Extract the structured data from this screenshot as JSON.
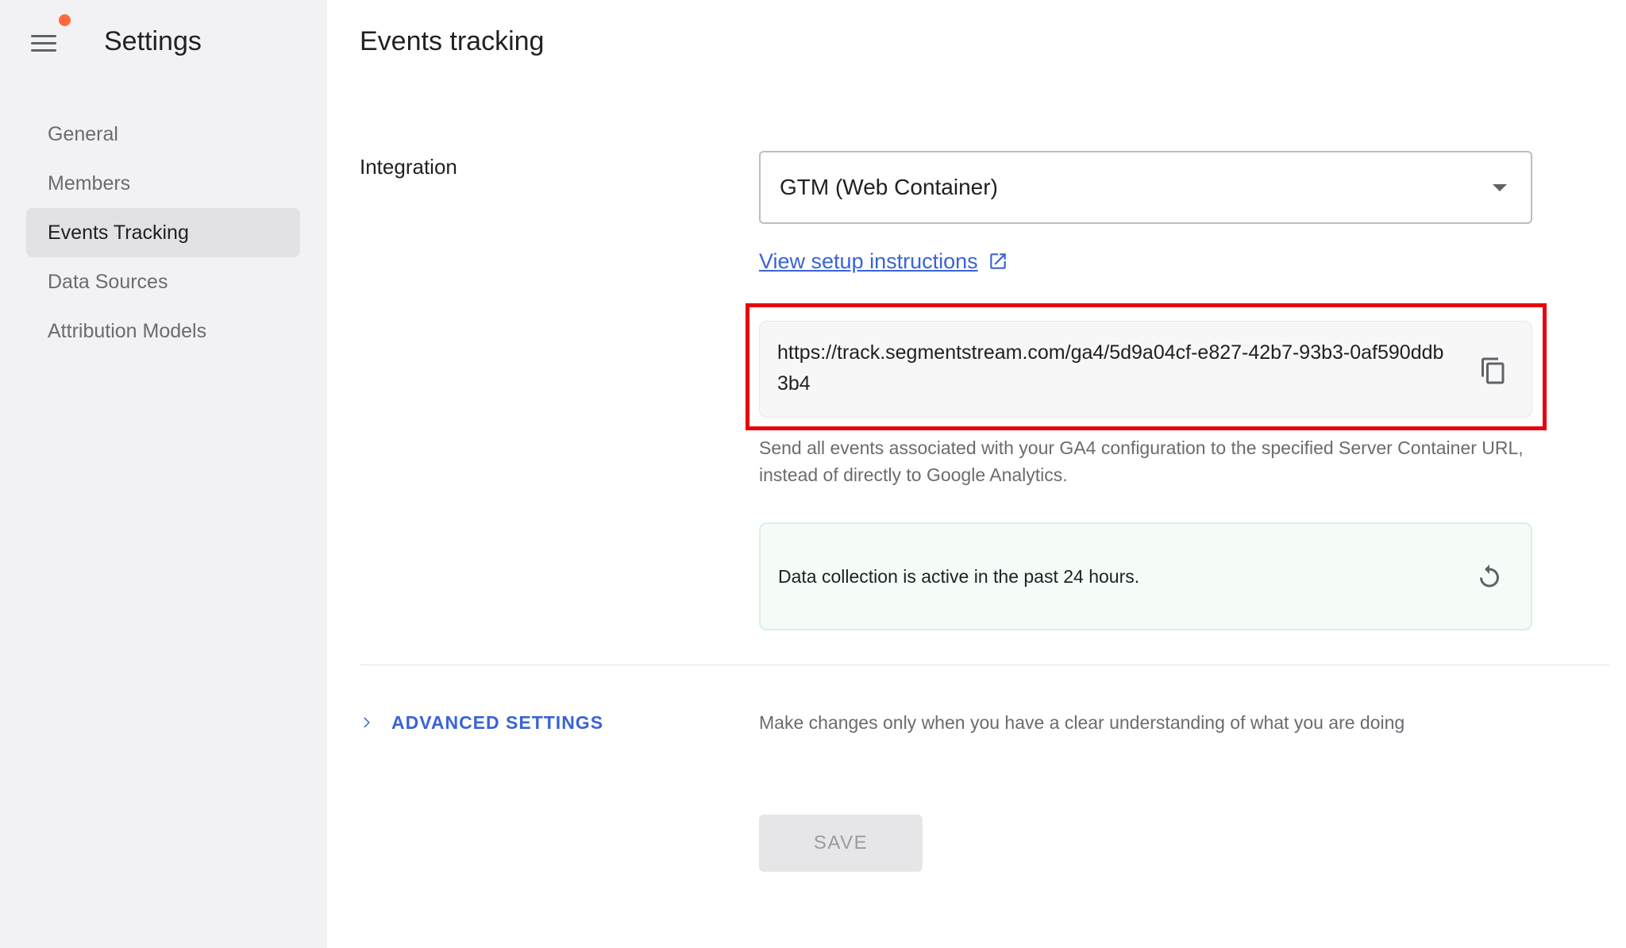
{
  "sidebar": {
    "title": "Settings",
    "items": [
      {
        "label": "General",
        "active": false
      },
      {
        "label": "Members",
        "active": false
      },
      {
        "label": "Events Tracking",
        "active": true
      },
      {
        "label": "Data Sources",
        "active": false
      },
      {
        "label": "Attribution Models",
        "active": false
      }
    ]
  },
  "main": {
    "title": "Events tracking",
    "integration": {
      "label": "Integration",
      "selected": "GTM (Web Container)"
    },
    "setup_link": "View setup instructions",
    "tracking_url": "https://track.segmentstream.com/ga4/5d9a04cf-e827-42b7-93b3-0af590ddb3b4",
    "helper_text": "Send all events associated with your GA4 configuration to the specified Server Container URL, instead of directly to Google Analytics.",
    "status_text": "Data collection is active in the past 24 hours.",
    "advanced": {
      "label": "ADVANCED SETTINGS",
      "note": "Make changes only when you have a clear understanding of what you are doing"
    },
    "save_label": "SAVE"
  },
  "icons": {
    "menu": "menu-icon",
    "notification": "notification-dot-icon",
    "dropdown": "caret-down-icon",
    "external_link": "external-link-icon",
    "copy": "copy-icon",
    "refresh": "refresh-icon",
    "chevron": "chevron-right-icon"
  },
  "colors": {
    "accent": "#3a63d6",
    "highlight": "#e8000d",
    "notification_dot": "#ff6a3d",
    "sidebar_bg": "#f2f2f4",
    "status_bg": "#f5fcf7"
  }
}
